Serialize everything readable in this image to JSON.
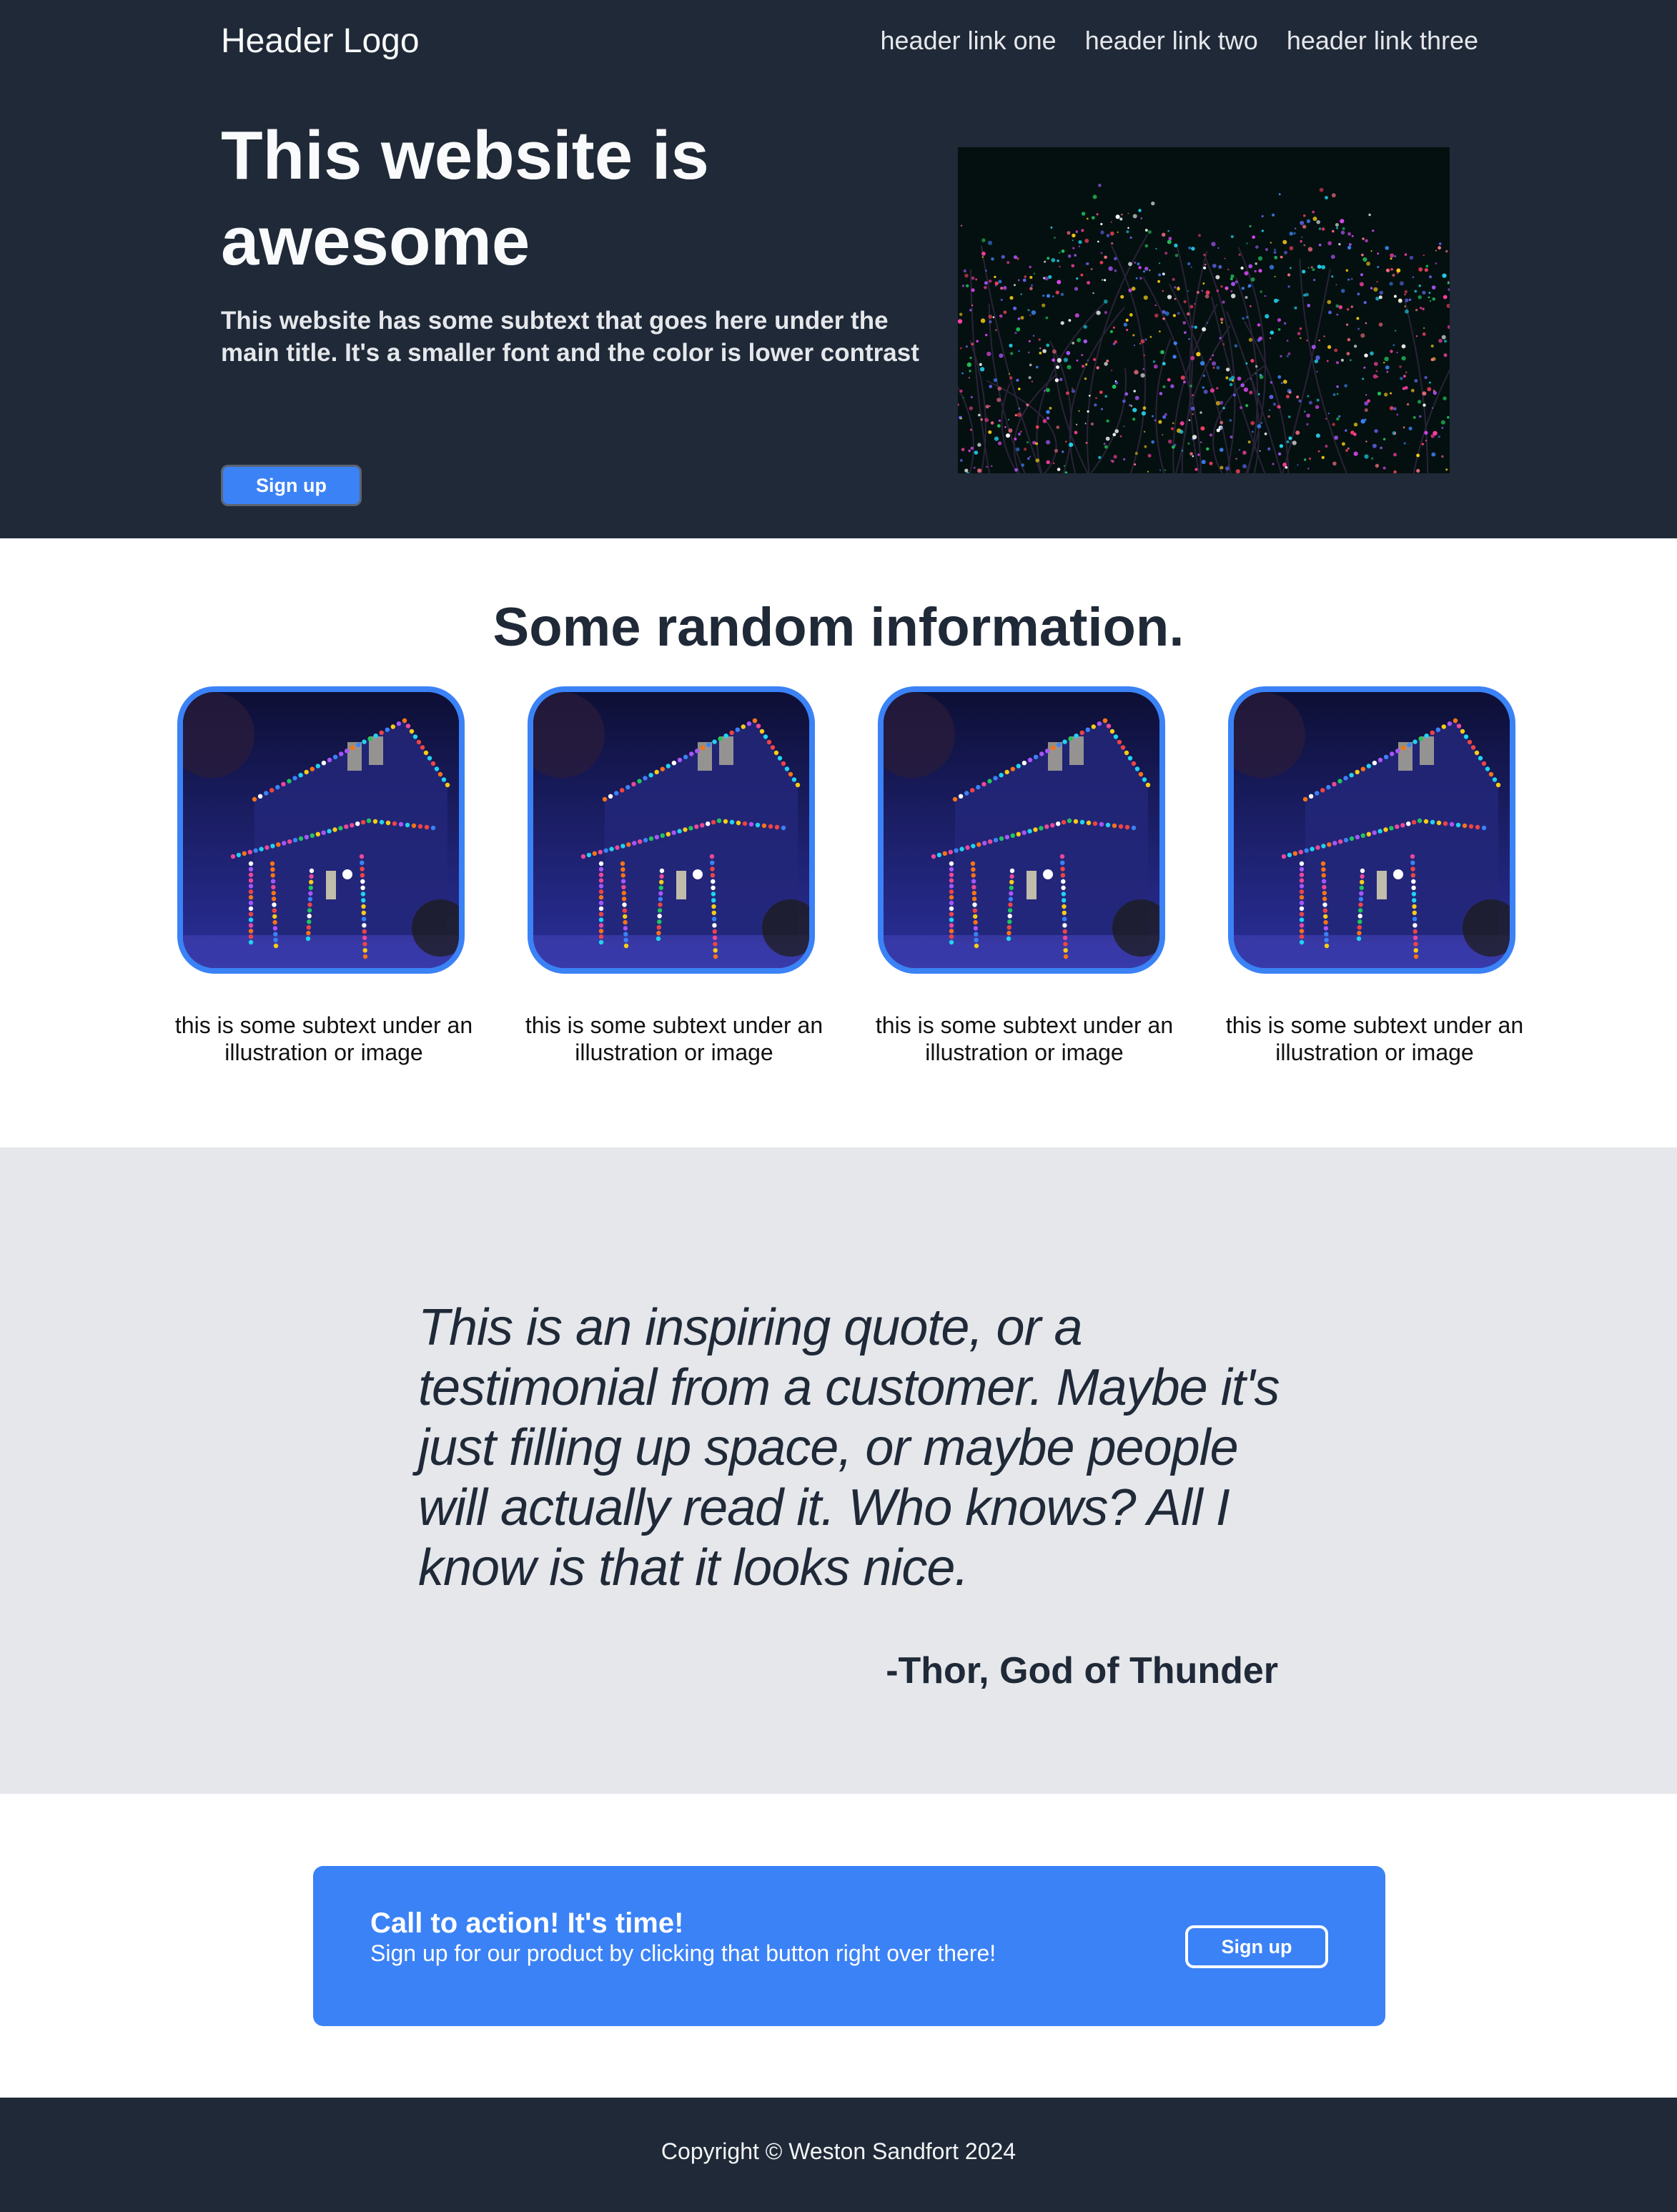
{
  "header": {
    "logo": "Header Logo",
    "links": [
      "header link one",
      "header link two",
      "header link three"
    ]
  },
  "hero": {
    "title": "This website is awesome",
    "subtext": "This website has some subtext that goes here under the main title. It's a smaller font and the color is lower contrast",
    "button_label": "Sign up",
    "image_icon": "string-lights-trees-image"
  },
  "info": {
    "title": "Some random information.",
    "cards": [
      {
        "image_icon": "lit-house-image",
        "text": "this is some subtext under an illustration or image"
      },
      {
        "image_icon": "lit-house-image",
        "text": "this is some subtext under an illustration or image"
      },
      {
        "image_icon": "lit-house-image",
        "text": "this is some subtext under an illustration or image"
      },
      {
        "image_icon": "lit-house-image",
        "text": "this is some subtext under an illustration or image"
      }
    ]
  },
  "quote": {
    "text": "This is an inspiring quote, or a testimonial from a customer. Maybe it's just filling up space, or maybe people will actually read it. Who knows? All I know is that it looks nice.",
    "author": "-Thor, God of Thunder"
  },
  "cta": {
    "title": "Call to action! It's time!",
    "subtext": "Sign up for our product by clicking that button right over there!",
    "button_label": "Sign up"
  },
  "footer": {
    "copyright": "Copyright © Weston Sandfort 2024"
  },
  "colors": {
    "dark": "#1f2937",
    "accent": "#3b82f6",
    "light_gray": "#e5e7eb",
    "white": "#ffffff"
  }
}
